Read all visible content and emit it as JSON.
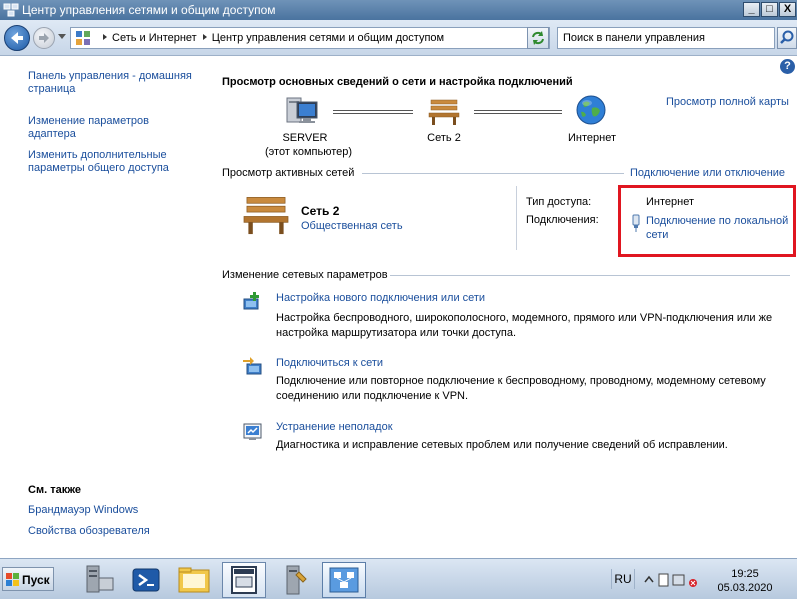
{
  "window": {
    "title": "Центр управления сетями и общим доступом",
    "min": "_",
    "max": "□",
    "close": "X"
  },
  "address": {
    "crumb1": "Сеть и Интернет",
    "crumb2": "Центр управления сетями и общим доступом",
    "search_value": "Поиск в панели управления"
  },
  "help": "?",
  "sidebar": {
    "home": "Панель управления - домашняя страница",
    "adapter": "Изменение параметров адаптера",
    "sharing": "Изменить дополнительные параметры общего доступа",
    "see_also": "См. также",
    "firewall": "Брандмауэр Windows",
    "browser": "Свойства обозревателя"
  },
  "main": {
    "heading": "Просмотр основных сведений о сети и настройка подключений",
    "full_map": "Просмотр полной карты",
    "map": {
      "server_name": "SERVER",
      "server_sub": "(этот компьютер)",
      "network": "Сеть  2",
      "internet": "Интернет"
    },
    "active_title": "Просмотр активных сетей",
    "connect_toggle": "Подключение или отключение",
    "net_name": "Сеть  2",
    "net_type": "Общественная сеть",
    "access_label": "Тип доступа:",
    "access_value": "Интернет",
    "conn_label": "Подключения:",
    "conn_value_1": "Подключение по локальной",
    "conn_value_2": "сети",
    "change_title": "Изменение сетевых параметров",
    "tasks": [
      {
        "title": "Настройка нового подключения или сети",
        "desc1": "Настройка беспроводного, широкополосного, модемного, прямого или VPN-подключения или же",
        "desc2": "настройка маршрутизатора или точки доступа."
      },
      {
        "title": "Подключиться к сети",
        "desc1": "Подключение или повторное подключение к беспроводному, проводному, модемному сетевому",
        "desc2": "соединению или подключение к VPN."
      },
      {
        "title": "Устранение неполадок",
        "desc1": "Диагностика и исправление сетевых проблем или получение сведений об исправлении."
      }
    ]
  },
  "taskbar": {
    "start": "Пуск",
    "lang": "RU",
    "time": "19:25",
    "date": "05.03.2020",
    "apps": [
      "server-manager-icon",
      "powershell-icon",
      "explorer-folder-icon",
      "window-app-icon",
      "tools-icon",
      "network-center-icon"
    ]
  },
  "colors": {
    "link": "#1a4e9c",
    "highlight_box": "#e01620",
    "titlebar": "#4a739f"
  }
}
